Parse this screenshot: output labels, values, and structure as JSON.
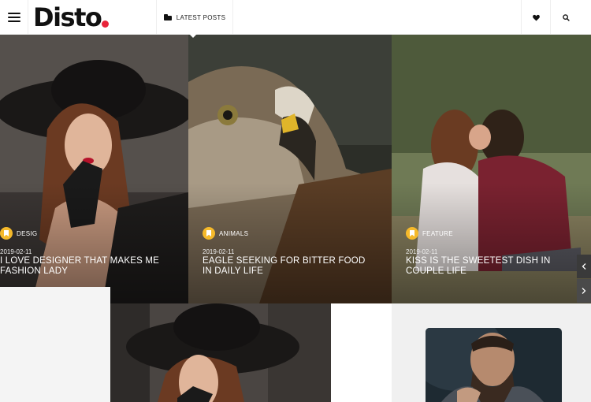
{
  "header": {
    "logo": "Disto",
    "nav_label": "LATEST POSTS",
    "icons": {
      "menu": "hamburger-icon",
      "nav": "folder-icon",
      "favorites": "heart-icon",
      "search": "search-icon"
    },
    "logo_dot_color": "#e8243a"
  },
  "posts": [
    {
      "category": "DESIG",
      "date": "2019-02-11",
      "title": "I LOVE DESIGNER THAT MAKES ME FASHION LADY",
      "image": "woman in black hat"
    },
    {
      "category": "ANIMALS",
      "date": "2019-02-11",
      "title": "EAGLE SEEKING FOR BITTER FOOD IN DAILY LIFE",
      "image": "eagle portrait"
    },
    {
      "category": "FEATURE",
      "date": "2019-02-11",
      "title": "KISS IS THE SWEETEST DISH IN COUPLE LIFE",
      "image": "couple kissing in field"
    }
  ],
  "category_badge_color": "#f5b92a",
  "category_icon": "bookmark-icon",
  "slider": {
    "prev_icon": "chevron-left-icon",
    "next_icon": "chevron-right-icon"
  }
}
